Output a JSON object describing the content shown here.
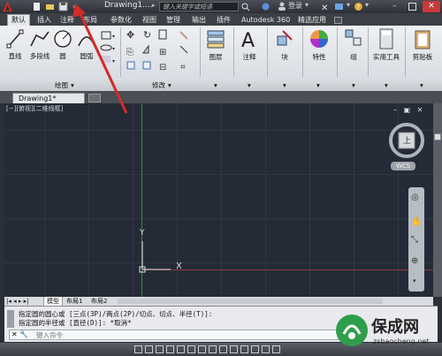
{
  "app": {
    "title": "Drawing1....",
    "search_placeholder": "键入关键字或短语",
    "login": "登录"
  },
  "tabs": [
    "默认",
    "插入",
    "注释",
    "布局",
    "参数化",
    "视图",
    "管理",
    "输出",
    "插件",
    "Autodesk 360",
    "精选应用"
  ],
  "ribbon": {
    "draw_buttons": [
      "直线",
      "多段线",
      "圆",
      "圆弧"
    ],
    "big_buttons": [
      "图层",
      "注释",
      "块",
      "特性",
      "组",
      "实用工具",
      "剪贴板"
    ],
    "panel_labels": {
      "draw": "绘图",
      "modify": "修改"
    }
  },
  "document_tab": "Drawing1*",
  "viewport_label": "[−][俯视][二维线框]",
  "viewcube": {
    "face": "上",
    "wcs": "WCS"
  },
  "ucs": {
    "y": "Y",
    "x": "X"
  },
  "layout_tabs": [
    "模型",
    "布局1",
    "布局2"
  ],
  "command": {
    "line1": "指定圆的圆心或 [三点(3P)/两点(2P)/切点、切点、半径(T)]:",
    "line2": "指定圆的半径或 [直径(D)]: *取消*",
    "input_placeholder": "键入命令"
  },
  "watermark": {
    "brand": "保成网",
    "url": "zsbaocheng.net"
  },
  "colors": {
    "canvas": "#252b36",
    "accent_red": "#d42a2a",
    "ribbon": "#e6e8ec"
  }
}
